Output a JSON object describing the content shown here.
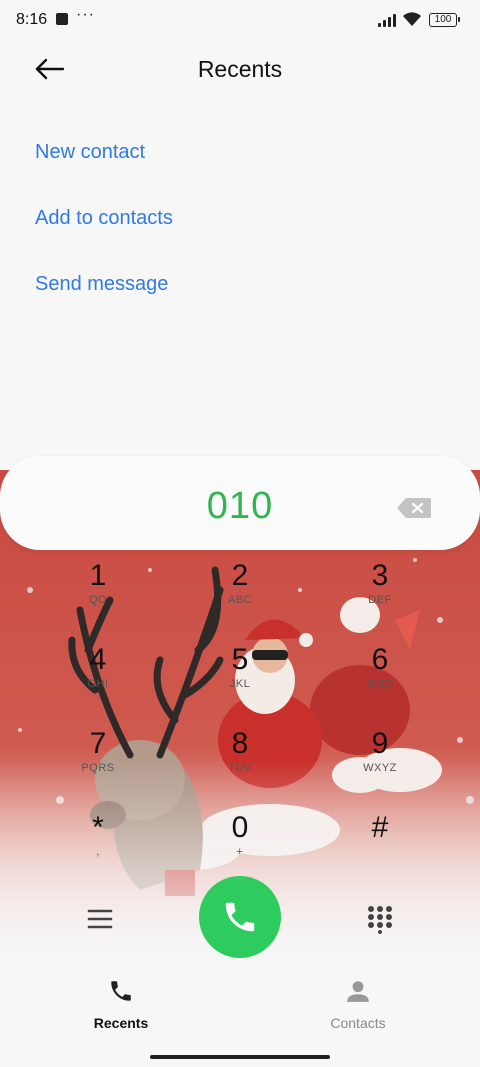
{
  "status_bar": {
    "time": "8:16",
    "dots": "···",
    "battery": "100"
  },
  "header": {
    "title": "Recents"
  },
  "actions": [
    {
      "label": "New contact"
    },
    {
      "label": "Add to contacts"
    },
    {
      "label": "Send message"
    }
  ],
  "dialer": {
    "number": "010",
    "keys": [
      {
        "digit": "1",
        "letters": "QO"
      },
      {
        "digit": "2",
        "letters": "ABC"
      },
      {
        "digit": "3",
        "letters": "DEF"
      },
      {
        "digit": "4",
        "letters": "GHI"
      },
      {
        "digit": "5",
        "letters": "JKL"
      },
      {
        "digit": "6",
        "letters": "MNO"
      },
      {
        "digit": "7",
        "letters": "PQRS"
      },
      {
        "digit": "8",
        "letters": "TUV"
      },
      {
        "digit": "9",
        "letters": "WXYZ"
      },
      {
        "digit": "*",
        "letters": ","
      },
      {
        "digit": "0",
        "letters": "+"
      },
      {
        "digit": "#",
        "letters": ""
      }
    ]
  },
  "bottom_nav": {
    "recents": "Recents",
    "contacts": "Contacts"
  },
  "colors": {
    "accent_link": "#2f7ae5",
    "number": "#2fb64e",
    "call": "#2ecc5e",
    "art_red": "#c94a42"
  },
  "icons": {
    "back": "arrow-left-icon",
    "backspace": "backspace-icon",
    "menu": "menu-icon",
    "call": "phone-icon",
    "keypad": "dialpad-icon",
    "recents": "phone-icon",
    "contacts": "person-icon"
  }
}
